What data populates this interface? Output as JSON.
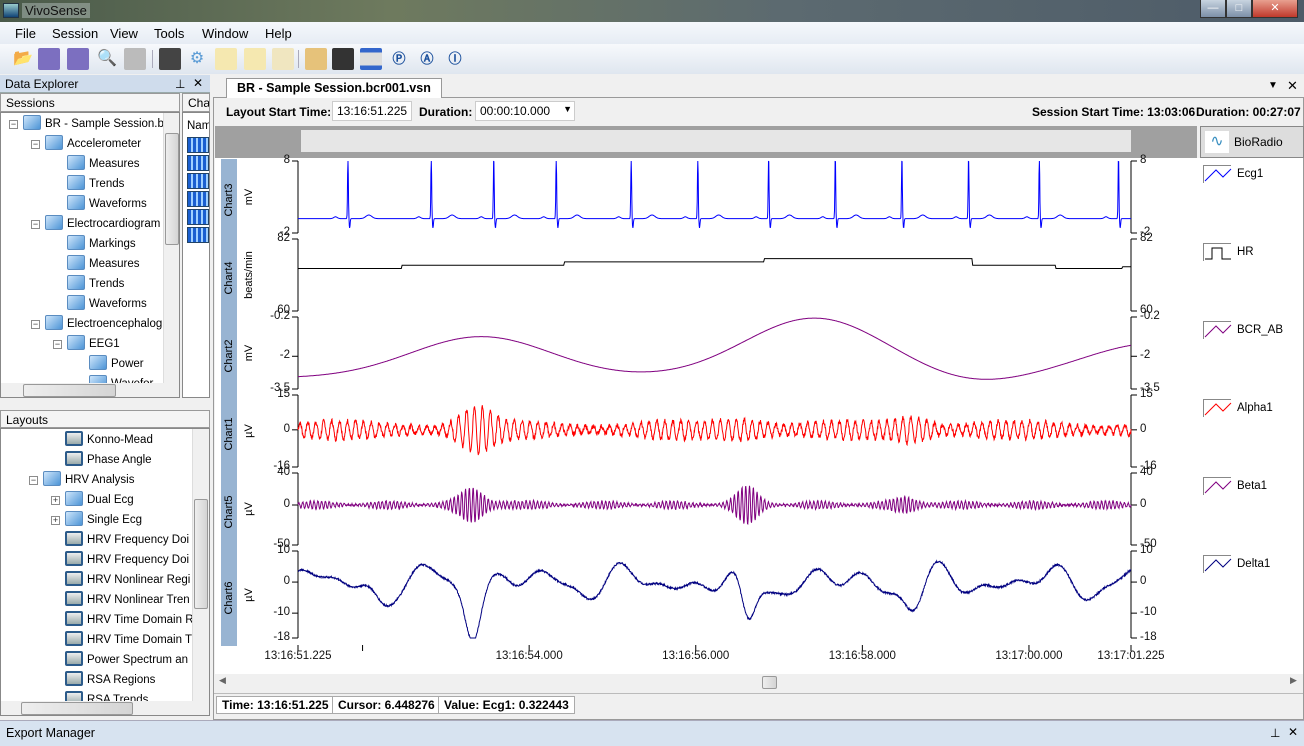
{
  "app": {
    "title": "VivoSense"
  },
  "window_controls": {
    "minimize": "—",
    "maximize": "□",
    "close": "✕"
  },
  "menu": [
    "File",
    "Session",
    "View",
    "Tools",
    "Window",
    "Help"
  ],
  "toolbar_icons": [
    "open-folder-icon",
    "save-icon",
    "save-as-icon",
    "print-preview-icon",
    "print-icon",
    "database-icon",
    "settings-gear-icon",
    "notes-icon",
    "export-icon",
    "copy-pages-icon",
    "import-icon",
    "lock-icon",
    "layout-bars-icon",
    "p-marker-icon",
    "a-marker-icon",
    "i-marker-icon"
  ],
  "data_explorer": {
    "title": "Data Explorer",
    "pin": "⊥",
    "close": "✕",
    "sessions_tab": "Sessions",
    "charts_tab": "Char",
    "charts_col": "Nam",
    "tree": [
      {
        "label": "BR - Sample Session.bc",
        "level": 0,
        "exp": "-"
      },
      {
        "label": "Accelerometer",
        "level": 1,
        "exp": "-"
      },
      {
        "label": "Measures",
        "level": 2
      },
      {
        "label": "Trends",
        "level": 2
      },
      {
        "label": "Waveforms",
        "level": 2
      },
      {
        "label": "Electrocardiogram",
        "level": 1,
        "exp": "-"
      },
      {
        "label": "Markings",
        "level": 2
      },
      {
        "label": "Measures",
        "level": 2
      },
      {
        "label": "Trends",
        "level": 2
      },
      {
        "label": "Waveforms",
        "level": 2
      },
      {
        "label": "Electroencephalog",
        "level": 1,
        "exp": "-"
      },
      {
        "label": "EEG1",
        "level": 2,
        "exp": "-"
      },
      {
        "label": "Power",
        "level": 3
      },
      {
        "label": "Wavefor",
        "level": 3
      }
    ]
  },
  "layouts": {
    "title": "Layouts",
    "tree": [
      {
        "label": "Konno-Mead",
        "level": 2,
        "type": "layout"
      },
      {
        "label": "Phase Angle",
        "level": 2,
        "type": "layout"
      },
      {
        "label": "HRV Analysis",
        "level": 1,
        "type": "folder",
        "exp": "-"
      },
      {
        "label": "Dual Ecg",
        "level": 2,
        "type": "folder",
        "exp": "+"
      },
      {
        "label": "Single Ecg",
        "level": 2,
        "type": "folder",
        "exp": "+"
      },
      {
        "label": "HRV Frequency Doi",
        "level": 2,
        "type": "layout"
      },
      {
        "label": "HRV Frequency Doi",
        "level": 2,
        "type": "layout"
      },
      {
        "label": "HRV Nonlinear Regi",
        "level": 2,
        "type": "layout"
      },
      {
        "label": "HRV Nonlinear Tren",
        "level": 2,
        "type": "layout"
      },
      {
        "label": "HRV Time Domain R",
        "level": 2,
        "type": "layout"
      },
      {
        "label": "HRV Time Domain T",
        "level": 2,
        "type": "layout"
      },
      {
        "label": "Power Spectrum an",
        "level": 2,
        "type": "layout"
      },
      {
        "label": "RSA Regions",
        "level": 2,
        "type": "layout"
      },
      {
        "label": "RSA Trends",
        "level": 2,
        "type": "layout"
      }
    ]
  },
  "document": {
    "tab": "BR - Sample Session.bcr001.vsn",
    "layout_start_label": "Layout Start Time:",
    "layout_start_value": "13:16:51.225",
    "duration_label": "Duration:",
    "duration_value": "00:00:10.000",
    "session_start": "Session Start Time: 13:03:06",
    "session_duration": "Duration: 00:27:07",
    "device": "BioRadio"
  },
  "charts": [
    {
      "name": "Chart3",
      "unit": "mV",
      "ticks": [
        "8",
        "-2"
      ],
      "range": [
        -2,
        8
      ],
      "series": "Ecg1",
      "color": "#0000ff"
    },
    {
      "name": "Chart4",
      "unit": "beats/min",
      "ticks": [
        "82",
        "60"
      ],
      "range": [
        60,
        82
      ],
      "series": "HR",
      "color": "#000000"
    },
    {
      "name": "Chart2",
      "unit": "mV",
      "ticks": [
        "-0.2",
        "-2",
        "-3.5"
      ],
      "range": [
        -3.5,
        -0.2
      ],
      "series": "BCR_AB",
      "color": "#800080"
    },
    {
      "name": "Chart1",
      "unit": "µV",
      "ticks": [
        "15",
        "0",
        "-16"
      ],
      "range": [
        -16,
        15
      ],
      "series": "Alpha1",
      "color": "#ff0000"
    },
    {
      "name": "Chart5",
      "unit": "µV",
      "ticks": [
        "40",
        "0",
        "-50"
      ],
      "range": [
        -50,
        40
      ],
      "series": "Beta1",
      "color": "#800080"
    },
    {
      "name": "Chart6",
      "unit": "µV",
      "ticks": [
        "10",
        "0",
        "-10",
        "-18"
      ],
      "range": [
        -18,
        10
      ],
      "series": "Delta1",
      "color": "#000080"
    }
  ],
  "x_axis": {
    "ticks": [
      "13:16:51.225",
      "13:16:54.000",
      "13:16:56.000",
      "13:16:58.000",
      "13:17:00.000",
      "13:17:01.225"
    ]
  },
  "status": {
    "time": "Time: 13:16:51.225",
    "cursor": "Cursor: 6.448276",
    "value": "Value: Ecg1: 0.322443"
  },
  "export_manager": {
    "title": "Export Manager",
    "pin": "⊥",
    "close": "✕"
  }
}
